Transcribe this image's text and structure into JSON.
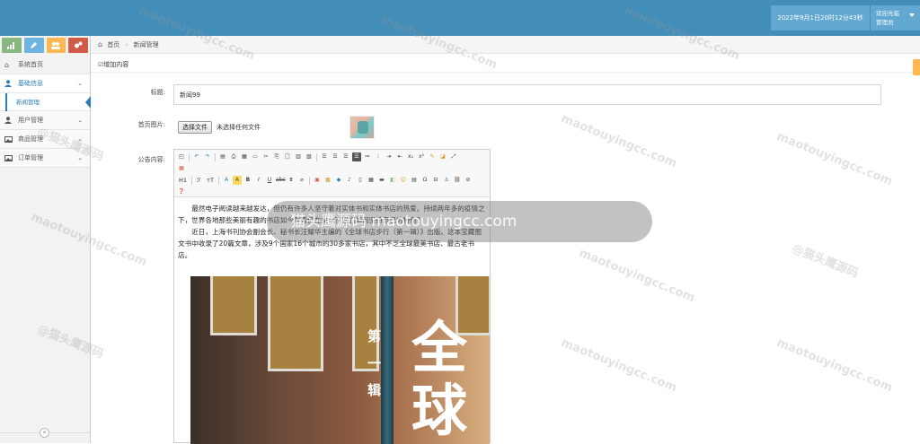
{
  "header": {
    "datetime": "2022年9月1日20时12分43秒",
    "welcome": "欢迎光临",
    "role": "管理员"
  },
  "sidebar": {
    "items": [
      {
        "label": "系统首页",
        "icon": "home-icon"
      },
      {
        "label": "基础信息",
        "icon": "user-icon",
        "open": true,
        "children": [
          {
            "label": "新闻管理",
            "active": true
          }
        ]
      },
      {
        "label": "用户管理",
        "icon": "user-icon"
      },
      {
        "label": "商品管理",
        "icon": "picture-icon"
      },
      {
        "label": "订单管理",
        "icon": "picture-icon"
      }
    ],
    "shortcut_colors": [
      "#87b87f",
      "#6fb3e0",
      "#ffb752",
      "#d15b47"
    ]
  },
  "breadcrumb": {
    "home": "首页",
    "current": "新闻管理"
  },
  "page": {
    "heading": "增加内容"
  },
  "form": {
    "title_label": "标题:",
    "title_value": "新闻99",
    "image_label": "首页图片:",
    "file_button": "选择文件",
    "file_status": "未选择任何文件",
    "content_label": "公告内容:"
  },
  "editor": {
    "toolbar_h1": "H1",
    "toolbar_font": "ℱ",
    "toolbar_size": "ᴛT",
    "paragraph1": "最然电子阅读越来越发达，但仍有许多人坚守着对实体书和实体书店的热爱。持续两年多的疫情之下，世界各地那些美丽有趣的书店如今是否仍在坚守？它们如何坚持自己的特色？",
    "paragraph2": "近日，上海书刊协会副会长、秘书长汪耀华主编的《全球书店步行（第一辑）》出版。这本宝藏图文书中收录了20篇文章，涉及9个国家16个城市的30多家书店，其中不乏全球最美书店、最古老书店。",
    "cover_vertical": [
      "第",
      "一",
      "辑"
    ],
    "cover_big": "全球"
  },
  "watermark": {
    "toast": "猫头鹰源码 maotouyingcc.com",
    "text": "maotouyingcc.com",
    "text_cn": "@猫头鹰源码"
  },
  "colors": {
    "topbar": "#438eb9",
    "accent": "#2b7dbc"
  }
}
